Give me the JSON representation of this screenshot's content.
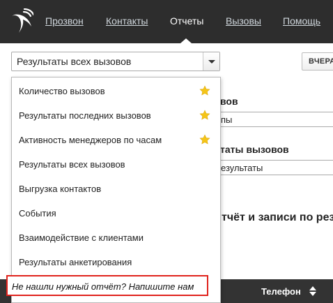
{
  "nav": {
    "items": [
      {
        "label": "Прозвон"
      },
      {
        "label": "Контакты"
      },
      {
        "label": "Отчеты"
      },
      {
        "label": "Вызовы"
      },
      {
        "label": "Помощь"
      }
    ],
    "active_index": 2
  },
  "report": {
    "selected": "Результаты всех вызовов",
    "yesterday_label": "ВЧЕРА"
  },
  "background": {
    "label1": "вов",
    "select1": "пы",
    "label2": "таты вызовов",
    "select2": "езультаты",
    "section_title": "тчёт и записи по рез"
  },
  "table": {
    "phone_header": "Телефон"
  },
  "dropdown": {
    "items": [
      {
        "label": "Количество вызовов",
        "starred": true
      },
      {
        "label": "Результаты последних вызовов",
        "starred": true
      },
      {
        "label": "Активность менеджеров по часам",
        "starred": true
      },
      {
        "label": "Результаты всех вызовов",
        "starred": false
      },
      {
        "label": "Выгрузка контактов",
        "starred": false
      },
      {
        "label": "События",
        "starred": false
      },
      {
        "label": "Взаимодействие с клиентами",
        "starred": false
      },
      {
        "label": "Результаты анкетирования",
        "starred": false
      }
    ],
    "feedback_link": "Не нашли нужный отчёт? Напишите нам"
  },
  "icons": {
    "logo": "bird-logo-icon",
    "star": "star-icon",
    "dropdown_arrow": "chevron-down-icon",
    "sort": "sort-icon"
  },
  "colors": {
    "topbar": "#2d2d2d",
    "star": "#f5c518",
    "highlight": "#e0221c",
    "table_header": "#333333"
  }
}
